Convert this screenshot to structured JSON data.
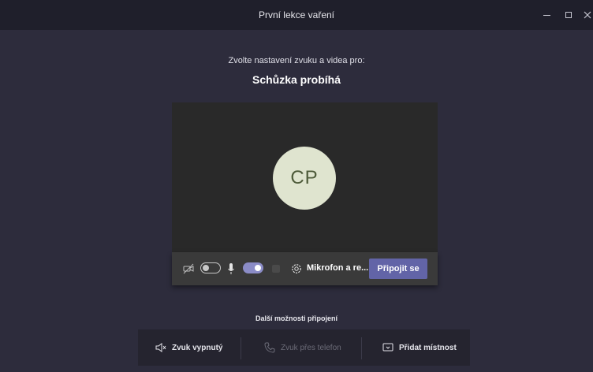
{
  "window": {
    "title": "První lekce vaření"
  },
  "prejoin": {
    "subtitle": "Zvolte nastavení zvuku a videa pro:",
    "meeting_title": "Schůzka probíhá",
    "avatar_initials": "CP",
    "camera_enabled": false,
    "mic_enabled": true,
    "device_settings_label": "Mikrofon a re...",
    "join_label": "Připojit se"
  },
  "more_options": {
    "title": "Další možnosti připojení",
    "audio_off_label": "Zvuk vypnutý",
    "phone_label": "Zvuk přes telefon",
    "add_room_label": "Přidat místnost"
  },
  "colors": {
    "accent": "#6264a7",
    "background": "#2d2c3c",
    "avatar_bg": "#dfe4cf"
  }
}
